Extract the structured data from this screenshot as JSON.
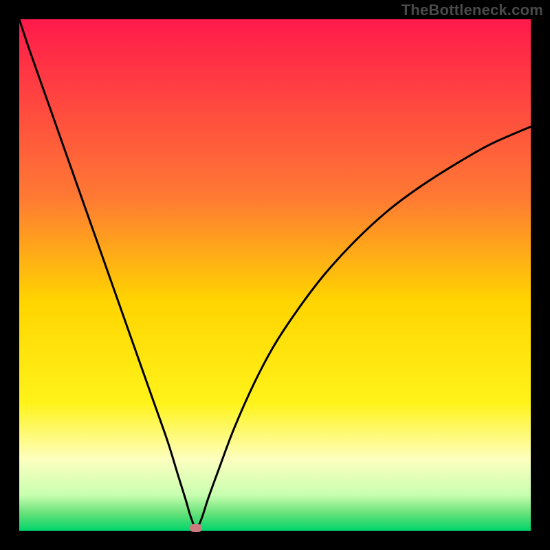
{
  "watermark": "TheBottleneck.com",
  "chart_data": {
    "type": "line",
    "title": "",
    "xlabel": "",
    "ylabel": "",
    "xlim": [
      0,
      100
    ],
    "ylim": [
      0,
      100
    ],
    "grid": false,
    "legend": false,
    "gradient_stops": [
      {
        "offset": 0,
        "color": "#ff1a4b"
      },
      {
        "offset": 0.35,
        "color": "#ff7a33"
      },
      {
        "offset": 0.55,
        "color": "#ffd400"
      },
      {
        "offset": 0.75,
        "color": "#fff31a"
      },
      {
        "offset": 0.86,
        "color": "#fdffbf"
      },
      {
        "offset": 0.93,
        "color": "#c8ffb0"
      },
      {
        "offset": 0.965,
        "color": "#69e27a"
      },
      {
        "offset": 1.0,
        "color": "#00d46a"
      }
    ],
    "series": [
      {
        "name": "bottleneck-curve",
        "color": "#000000",
        "x": [
          0,
          2,
          5,
          8,
          11,
          14,
          17,
          20,
          23,
          26,
          29,
          31,
          32.5,
          33.5,
          34.5,
          35.5,
          37,
          39,
          42,
          46,
          50,
          55,
          60,
          66,
          72,
          78,
          85,
          92,
          100
        ],
        "y": [
          100,
          94,
          85.5,
          77,
          68.5,
          60,
          51.5,
          43,
          34.5,
          26,
          17.5,
          11,
          6.2,
          2.8,
          0.6,
          2.0,
          6.5,
          12,
          20,
          29,
          36.5,
          44,
          50.5,
          57,
          62.5,
          67,
          71.5,
          75.5,
          79
        ]
      }
    ],
    "marker": {
      "x": 34.5,
      "y": 0.6,
      "color": "#cb7b80"
    }
  }
}
